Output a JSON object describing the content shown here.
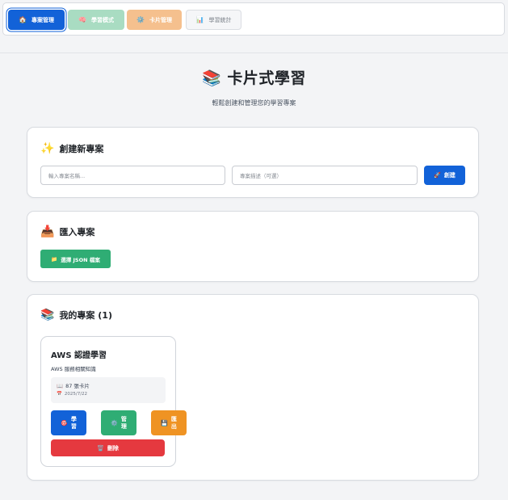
{
  "nav": {
    "home": {
      "icon": "🏠",
      "label": "專案管理"
    },
    "learn": {
      "icon": "🧠",
      "label": "學習模式"
    },
    "cards": {
      "icon": "⚙️",
      "label": "卡片管理"
    },
    "stats": {
      "icon": "📊",
      "label": "學習統計"
    }
  },
  "header": {
    "icon": "📚",
    "title": "卡片式學習",
    "subtitle": "輕鬆創建和管理您的學習專案"
  },
  "create": {
    "icon": "✨",
    "title": "創建新專案",
    "name_placeholder": "輸入專案名稱...",
    "desc_placeholder": "專案描述（可選）",
    "button_icon": "🚀",
    "button_label": "創建"
  },
  "import": {
    "icon": "📥",
    "title": "匯入專案",
    "button_icon": "📁",
    "button_label": "選擇 JSON 檔案"
  },
  "projects": {
    "icon": "📚",
    "title": "我的專案 (1)",
    "items": [
      {
        "name": "AWS 認證學習",
        "description": "AWS 服務相關知識",
        "cards_icon": "📖",
        "cards": "87 張卡片",
        "date_icon": "📅",
        "date": "2025/7/22",
        "study_icon": "🎯",
        "study_top": "學",
        "study_bottom": "習",
        "manage_icon": "⚙️",
        "manage_top": "管",
        "manage_bottom": "理",
        "export_icon": "💾",
        "export_top": "匯",
        "export_bottom": "出",
        "delete_icon": "🗑️",
        "delete_label": "刪除"
      }
    ]
  },
  "colors": {
    "primary": "#1262d8",
    "success": "#2fad74",
    "warning": "#ef9323",
    "danger": "#e5393f",
    "learn_tab": "#a9dcc2",
    "cards_tab": "#f5c08e"
  }
}
